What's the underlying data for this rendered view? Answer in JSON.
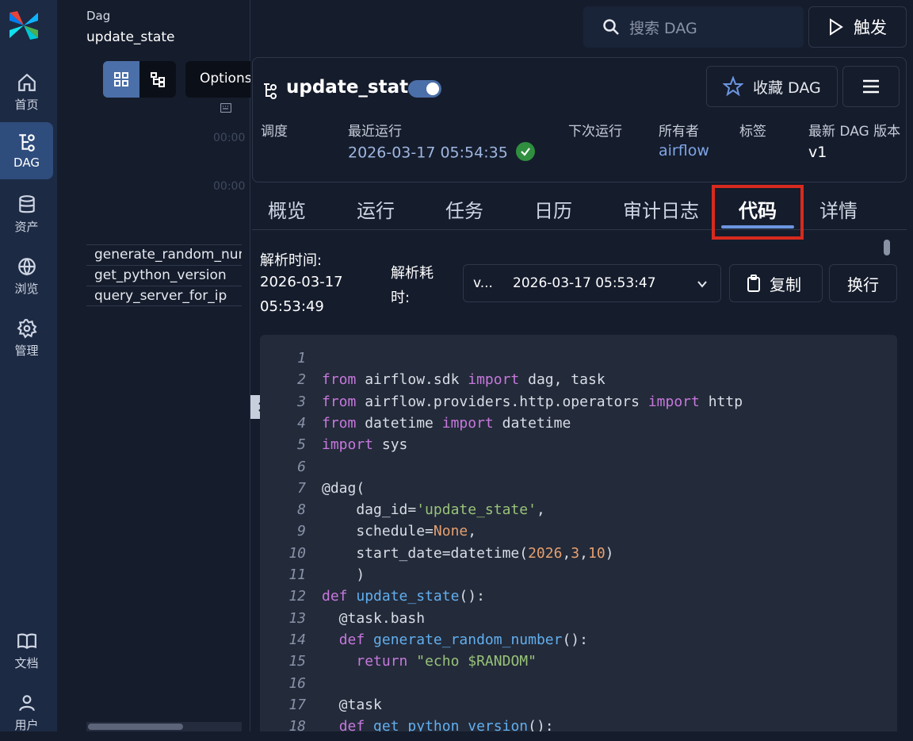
{
  "nav": {
    "items": [
      {
        "label": "首页",
        "icon": "home-icon"
      },
      {
        "label": "DAG",
        "icon": "dag-icon",
        "active": true
      },
      {
        "label": "资产",
        "icon": "database-icon"
      },
      {
        "label": "浏览",
        "icon": "globe-icon"
      },
      {
        "label": "管理",
        "icon": "gear-icon"
      },
      {
        "label": "文档",
        "icon": "book-icon"
      },
      {
        "label": "用户",
        "icon": "user-icon"
      }
    ]
  },
  "breadcrumb": {
    "section": "Dag",
    "name": "update_state"
  },
  "left_panel": {
    "options_label": "Options",
    "time_ticks": [
      "00:00",
      "00:00"
    ],
    "tasks": [
      "generate_random_number",
      "get_python_version",
      "query_server_for_ip"
    ]
  },
  "search": {
    "placeholder": "搜索 DAG"
  },
  "trigger": {
    "label": "触发"
  },
  "header": {
    "title": "update_state",
    "paused": false,
    "favorite_label": "收藏 DAG",
    "meta": {
      "schedule_label": "调度",
      "latest_run_label": "最近运行",
      "latest_run_value": "2026-03-17 05:54:35",
      "next_run_label": "下次运行",
      "owner_label": "所有者",
      "owner_value": "airflow",
      "tags_label": "标签",
      "version_label": "最新 DAG 版本",
      "version_value": "v1"
    }
  },
  "tabs": [
    {
      "label": "概览"
    },
    {
      "label": "运行"
    },
    {
      "label": "任务"
    },
    {
      "label": "日历"
    },
    {
      "label": "审计日志"
    },
    {
      "label": "代码",
      "active": true
    },
    {
      "label": "详情"
    }
  ],
  "code_toolbar": {
    "parse_time_label": "解析时间:",
    "parse_time_date": "2026-03-17",
    "parse_time_clock": "05:53:49",
    "parse_duration_label_1": "解析耗",
    "parse_duration_label_2": "时:",
    "version_short": "v...",
    "version_timestamp": "2026-03-17 05:53:47",
    "copy_label": "复制",
    "wrap_label": "换行"
  },
  "code": {
    "lines": [
      [],
      [
        [
          "k",
          "from"
        ],
        [
          "d",
          " airflow.sdk "
        ],
        [
          "k",
          "import"
        ],
        [
          "d",
          " dag, task"
        ]
      ],
      [
        [
          "k",
          "from"
        ],
        [
          "d",
          " airflow.providers.http.operators "
        ],
        [
          "k",
          "import"
        ],
        [
          "d",
          " http"
        ]
      ],
      [
        [
          "k",
          "from"
        ],
        [
          "d",
          " datetime "
        ],
        [
          "k",
          "import"
        ],
        [
          "d",
          " datetime"
        ]
      ],
      [
        [
          "k",
          "import"
        ],
        [
          "d",
          " sys"
        ]
      ],
      [],
      [
        [
          "d",
          "@dag("
        ]
      ],
      [
        [
          "d",
          "    dag_id="
        ],
        [
          "s",
          "'update_state'"
        ],
        [
          "d",
          ","
        ]
      ],
      [
        [
          "d",
          "    schedule="
        ],
        [
          "n",
          "None"
        ],
        [
          "d",
          ","
        ]
      ],
      [
        [
          "d",
          "    start_date=datetime("
        ],
        [
          "n",
          "2026"
        ],
        [
          "d",
          ","
        ],
        [
          "n",
          "3"
        ],
        [
          "d",
          ","
        ],
        [
          "n",
          "10"
        ],
        [
          "d",
          ")"
        ]
      ],
      [
        [
          "d",
          "    )"
        ]
      ],
      [
        [
          "k",
          "def"
        ],
        [
          "d",
          " "
        ],
        [
          "f",
          "update_state"
        ],
        [
          "d",
          "():"
        ]
      ],
      [
        [
          "d",
          "  @task.bash"
        ]
      ],
      [
        [
          "d",
          "  "
        ],
        [
          "k",
          "def"
        ],
        [
          "d",
          " "
        ],
        [
          "f",
          "generate_random_number"
        ],
        [
          "d",
          "():"
        ]
      ],
      [
        [
          "d",
          "    "
        ],
        [
          "k",
          "return"
        ],
        [
          "d",
          " "
        ],
        [
          "s",
          "\"echo $RANDOM\""
        ]
      ],
      [],
      [
        [
          "d",
          "  @task"
        ]
      ],
      [
        [
          "d",
          "  "
        ],
        [
          "k",
          "def"
        ],
        [
          "d",
          " "
        ],
        [
          "f",
          "get_python_version"
        ],
        [
          "d",
          "():"
        ]
      ]
    ]
  },
  "colors": {
    "accent": "#4b6fa8",
    "highlight_box": "#d82a1e",
    "success": "#2f8f3f",
    "link": "#7fa6e6"
  }
}
